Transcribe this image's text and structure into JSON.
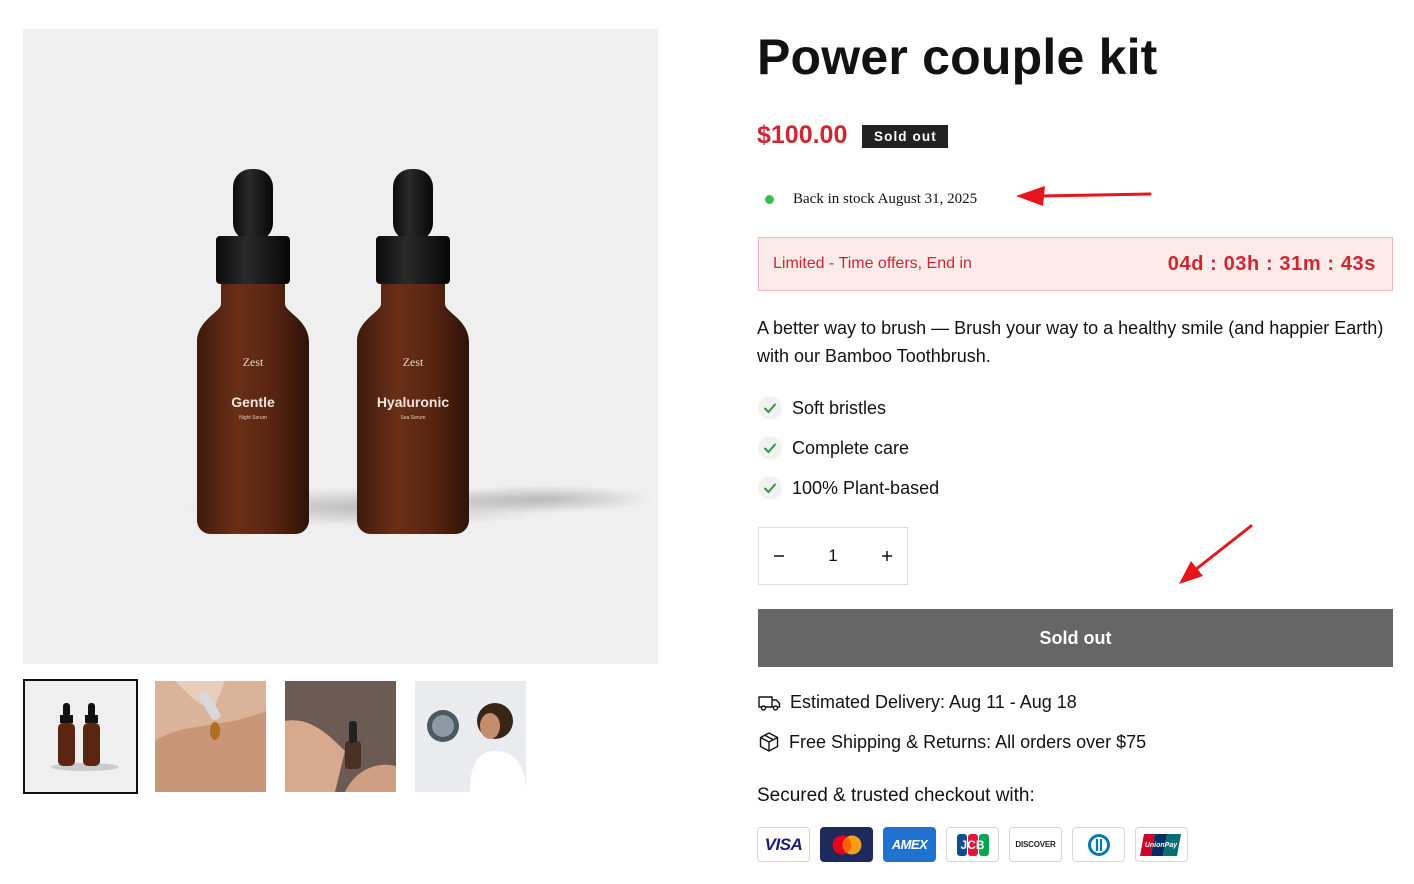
{
  "product": {
    "title": "Power couple kit",
    "price": "$100.00",
    "badge": "Sold out",
    "stock_text": "Back in stock August 31, 2025",
    "offer_label": "Limited - Time offers, End in",
    "offer_timer": "04d : 03h : 31m : 43s",
    "description": "A better way to brush — Brush your way to a healthy smile (and happier Earth) with our Bamboo Toothbrush.",
    "features": [
      "Soft bristles",
      "Complete care",
      "100% Plant-based"
    ],
    "quantity": "1",
    "buy_button": "Sold out",
    "delivery": "Estimated Delivery: Aug 11 - Aug 18",
    "shipping": "Free Shipping & Returns: All orders over $75",
    "secure_text": "Secured & trusted checkout with:"
  },
  "gallery": {
    "bottle_brand": "Zest",
    "bottle_left_name": "Gentle",
    "bottle_left_sub": "Night Serum",
    "bottle_right_name": "Hyaluronic",
    "bottle_right_sub": "Sea Serum"
  },
  "payment_methods": [
    "VISA",
    "Mastercard",
    "AMEX",
    "JCB",
    "DISCOVER",
    "Diners Club",
    "UnionPay"
  ],
  "colors": {
    "price": "#d0262f",
    "stock_dot": "#3ac04a",
    "sold_button": "#666666",
    "annotation_arrow": "#e8141c"
  }
}
